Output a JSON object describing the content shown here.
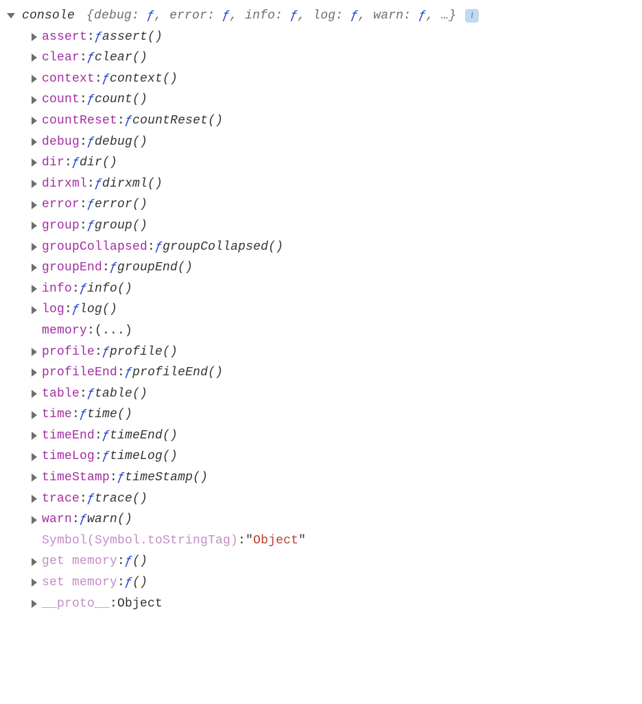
{
  "header": {
    "name": "console",
    "preview_prefix": "{",
    "preview_items": [
      {
        "key": "debug",
        "val": "ƒ"
      },
      {
        "key": "error",
        "val": "ƒ"
      },
      {
        "key": "info",
        "val": "ƒ"
      },
      {
        "key": "log",
        "val": "ƒ"
      },
      {
        "key": "warn",
        "val": "ƒ"
      }
    ],
    "preview_suffix": ", …}"
  },
  "rows": [
    {
      "expand": true,
      "name": "assert",
      "kind": "fn",
      "fn": "assert()"
    },
    {
      "expand": true,
      "name": "clear",
      "kind": "fn",
      "fn": "clear()"
    },
    {
      "expand": true,
      "name": "context",
      "kind": "fn",
      "fn": "context()"
    },
    {
      "expand": true,
      "name": "count",
      "kind": "fn",
      "fn": "count()"
    },
    {
      "expand": true,
      "name": "countReset",
      "kind": "fn",
      "fn": "countReset()"
    },
    {
      "expand": true,
      "name": "debug",
      "kind": "fn",
      "fn": "debug()"
    },
    {
      "expand": true,
      "name": "dir",
      "kind": "fn",
      "fn": "dir()"
    },
    {
      "expand": true,
      "name": "dirxml",
      "kind": "fn",
      "fn": "dirxml()"
    },
    {
      "expand": true,
      "name": "error",
      "kind": "fn",
      "fn": "error()"
    },
    {
      "expand": true,
      "name": "group",
      "kind": "fn",
      "fn": "group()"
    },
    {
      "expand": true,
      "name": "groupCollapsed",
      "kind": "fn",
      "fn": "groupCollapsed()"
    },
    {
      "expand": true,
      "name": "groupEnd",
      "kind": "fn",
      "fn": "groupEnd()"
    },
    {
      "expand": true,
      "name": "info",
      "kind": "fn",
      "fn": "info()"
    },
    {
      "expand": true,
      "name": "log",
      "kind": "fn",
      "fn": "log()"
    },
    {
      "expand": false,
      "name": "memory",
      "kind": "val",
      "val": "(...)"
    },
    {
      "expand": true,
      "name": "profile",
      "kind": "fn",
      "fn": "profile()"
    },
    {
      "expand": true,
      "name": "profileEnd",
      "kind": "fn",
      "fn": "profileEnd()"
    },
    {
      "expand": true,
      "name": "table",
      "kind": "fn",
      "fn": "table()"
    },
    {
      "expand": true,
      "name": "time",
      "kind": "fn",
      "fn": "time()"
    },
    {
      "expand": true,
      "name": "timeEnd",
      "kind": "fn",
      "fn": "timeEnd()"
    },
    {
      "expand": true,
      "name": "timeLog",
      "kind": "fn",
      "fn": "timeLog()"
    },
    {
      "expand": true,
      "name": "timeStamp",
      "kind": "fn",
      "fn": "timeStamp()"
    },
    {
      "expand": true,
      "name": "trace",
      "kind": "fn",
      "fn": "trace()"
    },
    {
      "expand": true,
      "name": "warn",
      "kind": "fn",
      "fn": "warn()"
    },
    {
      "expand": false,
      "name": "Symbol(Symbol.toStringTag)",
      "kind": "string",
      "val": "Object",
      "dim": true
    },
    {
      "expand": true,
      "name": "get memory",
      "kind": "fn",
      "fn": "()",
      "dim": true
    },
    {
      "expand": true,
      "name": "set memory",
      "kind": "fn",
      "fn": "()",
      "dim": true
    },
    {
      "expand": true,
      "name": "__proto__",
      "kind": "type",
      "val": "Object",
      "dim": true
    }
  ],
  "glyphs": {
    "fn_f": "ƒ",
    "info": "i"
  }
}
